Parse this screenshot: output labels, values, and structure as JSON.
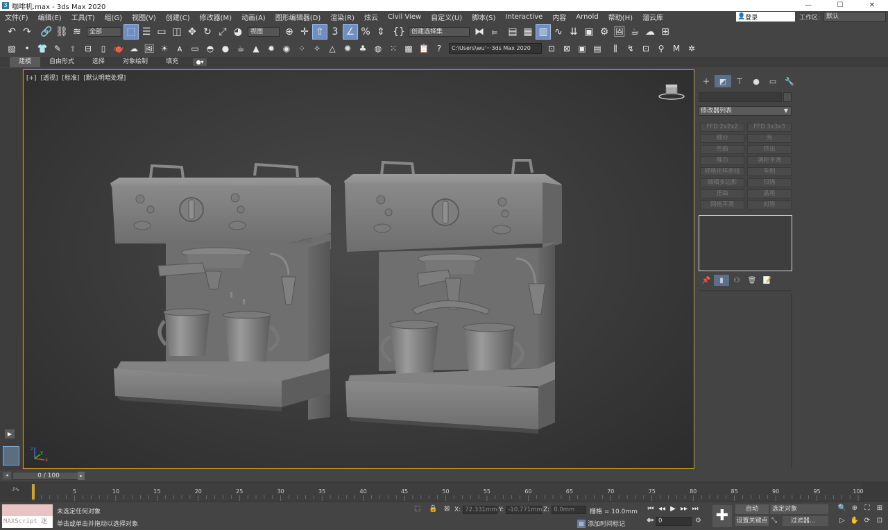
{
  "window": {
    "title": "咖啡机.max - 3ds Max 2020",
    "app_icon": "3",
    "min": "—",
    "max": "☐",
    "close": "✕"
  },
  "menu": [
    "文件(F)",
    "编辑(E)",
    "工具(T)",
    "组(G)",
    "视图(V)",
    "创建(C)",
    "修改器(M)",
    "动画(A)",
    "图形编辑器(D)",
    "渲染(R)",
    "炫云",
    "Civil View",
    "自定义(U)",
    "脚本(S)",
    "Interactive",
    "内容",
    "Arnold",
    "帮助(H)",
    "溜云库"
  ],
  "account": {
    "login": "登录",
    "workspace_label": "工作区:",
    "workspace_value": "默认"
  },
  "toolbar1": {
    "filter_select": "全部",
    "refcoord_select": "视图",
    "named_selection": "创建选择集"
  },
  "toolbar2": {
    "project_path": "C:\\Users\\wu'···3ds Max 2020"
  },
  "ribbon": {
    "tabs": [
      "建模",
      "自由形式",
      "选择",
      "对象绘制",
      "填充"
    ],
    "active": 0
  },
  "viewport": {
    "label_parts": [
      "[+]",
      "[透视]",
      "[标准]",
      "[默认明暗处理]"
    ],
    "axis_z": "z",
    "axis_x": "x",
    "axis_y": "y"
  },
  "command_panel": {
    "modifier_list_label": "修改器列表",
    "modifier_buttons": [
      "FFD 2x2x2",
      "FFD 3x3x3",
      "细分",
      "壳",
      "弯曲",
      "挤出",
      "推力",
      "涡轮平滑",
      "规格化样条线",
      "车削",
      "编辑多边形",
      "扫描",
      "扭曲",
      "晶格",
      "网格平滑",
      "对称"
    ]
  },
  "timeline": {
    "frame_display": "0 / 100",
    "ticks": [
      0,
      5,
      10,
      15,
      20,
      25,
      30,
      35,
      40,
      45,
      50,
      55,
      60,
      65,
      70,
      75,
      80,
      85,
      90,
      95,
      100
    ],
    "current": 0,
    "total": 100
  },
  "status": {
    "maxscript": "MAXScript 迷",
    "selection_status": "未选定任何对象",
    "prompt": "单击或单击并拖动以选择对象",
    "x_label": "X:",
    "x_value": "72.331mm",
    "y_label": "Y:",
    "y_value": "-10.771mm",
    "z_label": "Z:",
    "z_value": "0.0mm",
    "grid": "栅格 = 10.0mm",
    "add_time_tag": "添加时间标记",
    "auto_key": "自动",
    "set_key": "设置关键点",
    "selected_set": "选定对象",
    "filters": "过滤器...",
    "frame_value": "0"
  },
  "colors": {
    "viewport_border": "#c8a020",
    "active_button": "#6f8fc0",
    "maxscript_bg": "#e8c4c4"
  }
}
